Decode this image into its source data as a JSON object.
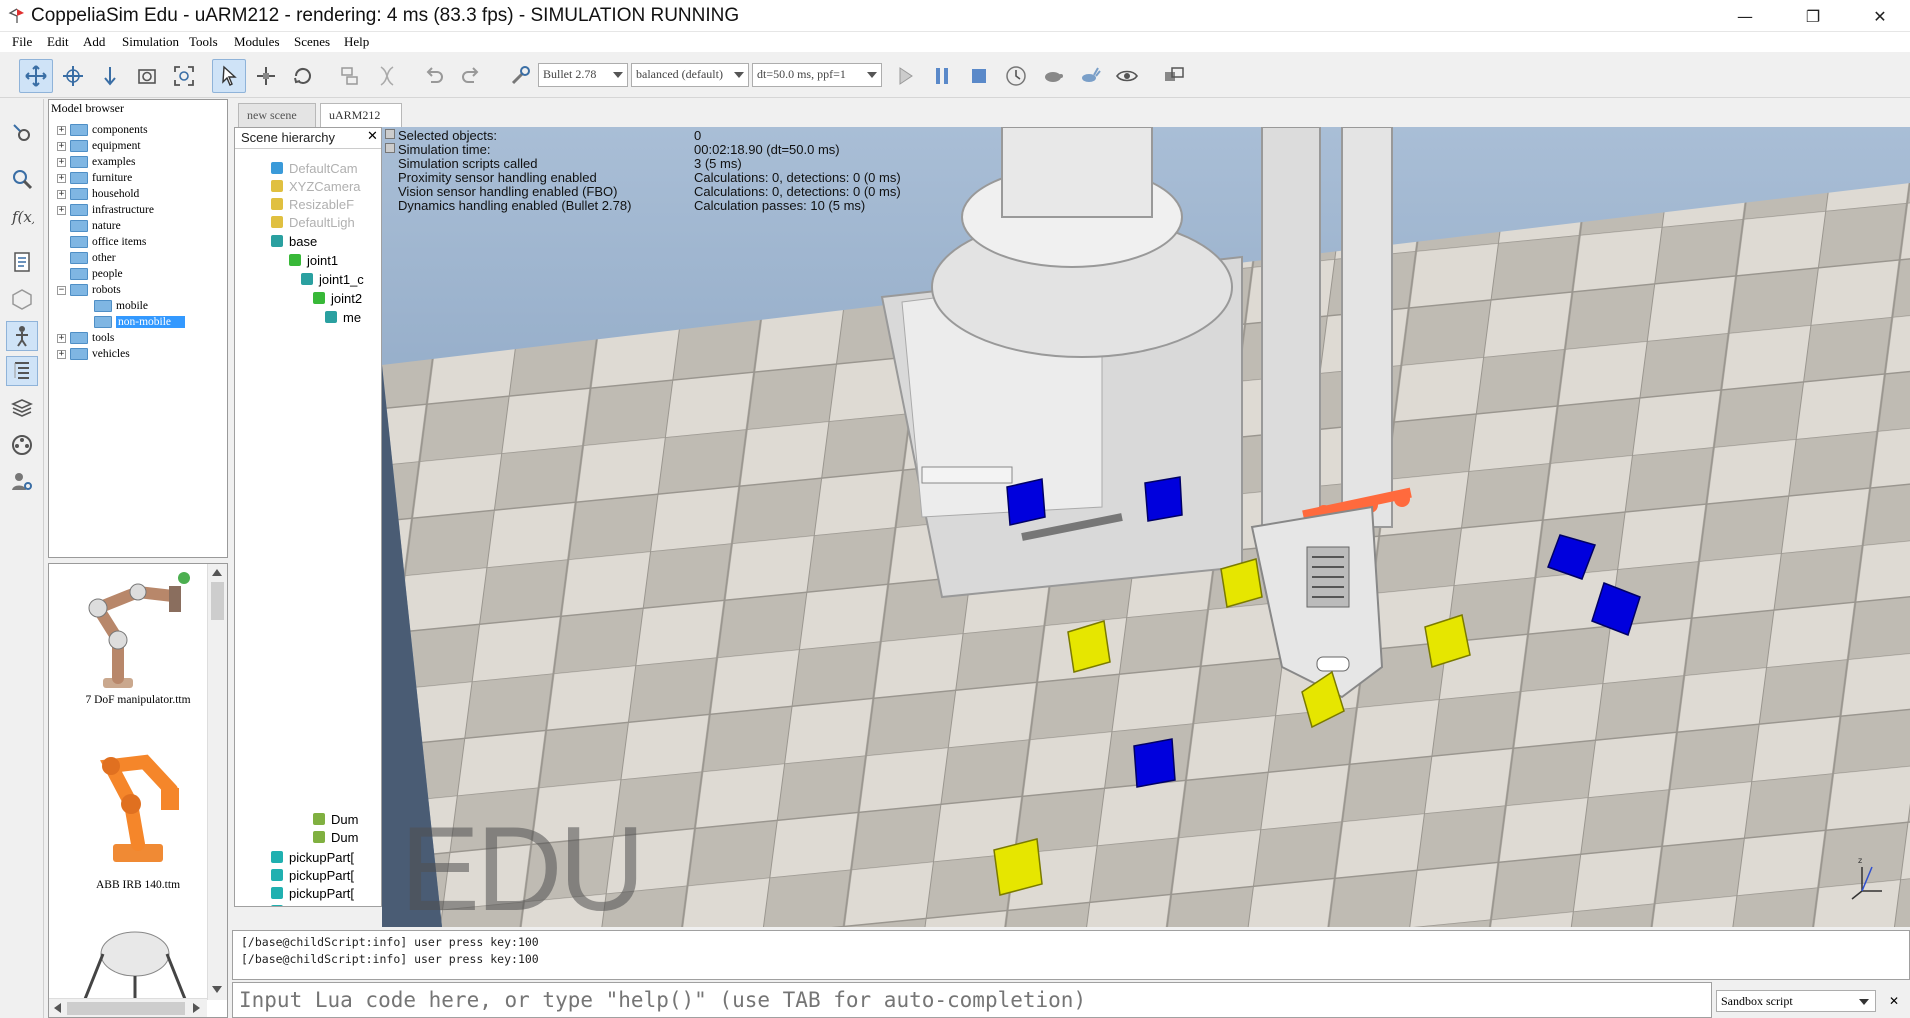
{
  "window": {
    "title": "CoppeliaSim Edu - uARM212 - rendering: 4 ms (83.3 fps) - SIMULATION RUNNING",
    "minimize": "—",
    "restore": "❐",
    "close": "✕"
  },
  "menu": [
    "File",
    "Edit",
    "Add",
    "Simulation",
    "Tools",
    "Modules",
    "Scenes",
    "Help"
  ],
  "toolbar": {
    "engine": "Bullet 2.78",
    "accuracy": "balanced (default)",
    "timestep": "dt=50.0 ms, ppf=1",
    "icons": [
      "move-camera-icon",
      "rotate-camera-icon",
      "shift-camera-icon",
      "zoom-camera-icon",
      "fit-view-icon",
      "select-icon",
      "object-shift-icon",
      "object-rotate-icon",
      "assembly-icon",
      "transfer-dna-icon",
      "undo-icon",
      "redo-icon",
      "dynamics-engine-icon",
      "play-icon",
      "pause-icon",
      "stop-icon",
      "realtime-icon",
      "slow-down-icon",
      "speed-up-icon",
      "visualization-icon",
      "page-selector-icon"
    ]
  },
  "model_browser": {
    "title": "Model browser",
    "items": [
      {
        "label": "components",
        "expander": "+",
        "level": 0
      },
      {
        "label": "equipment",
        "expander": "+",
        "level": 0
      },
      {
        "label": "examples",
        "expander": "+",
        "level": 0
      },
      {
        "label": "furniture",
        "expander": "+",
        "level": 0
      },
      {
        "label": "household",
        "expander": "+",
        "level": 0
      },
      {
        "label": "infrastructure",
        "expander": "+",
        "level": 0
      },
      {
        "label": "nature",
        "expander": "",
        "level": 0
      },
      {
        "label": "office items",
        "expander": "",
        "level": 0
      },
      {
        "label": "other",
        "expander": "",
        "level": 0
      },
      {
        "label": "people",
        "expander": "",
        "level": 0
      },
      {
        "label": "robots",
        "expander": "−",
        "level": 0
      },
      {
        "label": "mobile",
        "expander": "",
        "level": 1
      },
      {
        "label": "non-mobile",
        "expander": "",
        "level": 1,
        "selected": true
      },
      {
        "label": "tools",
        "expander": "+",
        "level": 0
      },
      {
        "label": "vehicles",
        "expander": "+",
        "level": 0
      }
    ],
    "thumbnails": [
      "7 DoF manipulator.ttm",
      "ABB IRB 140.ttm"
    ]
  },
  "tabs": [
    "new scene",
    "uARM212"
  ],
  "scene_hierarchy": {
    "title": "Scene hierarchy",
    "close": "✕",
    "items": [
      {
        "label": "DefaultCam",
        "dim": true
      },
      {
        "label": "XYZCamera",
        "dim": true
      },
      {
        "label": "ResizableF",
        "dim": true
      },
      {
        "label": "DefaultLigh",
        "dim": true
      },
      {
        "label": "base",
        "dim": false
      },
      {
        "label": "joint1",
        "dim": false
      },
      {
        "label": "joint1_c",
        "dim": false
      },
      {
        "label": "joint2",
        "dim": false
      },
      {
        "label": "me",
        "dim": false
      },
      {
        "label": "Dum",
        "dim": false
      },
      {
        "label": "Dum",
        "dim": false
      },
      {
        "label": "pickupPart[",
        "dim": false
      },
      {
        "label": "pickupPart[",
        "dim": false
      },
      {
        "label": "pickupPart[",
        "dim": false
      },
      {
        "label": "pickupPart[",
        "dim": false
      }
    ]
  },
  "sim_info": [
    {
      "label": "Selected objects:",
      "value": "0"
    },
    {
      "label": "Simulation time:",
      "value": "00:02:18.90 (dt=50.0 ms)"
    },
    {
      "label": "Simulation scripts called",
      "value": "3 (5 ms)"
    },
    {
      "label": "Proximity sensor handling enabled",
      "value": "Calculations: 0, detections: 0 (0 ms)"
    },
    {
      "label": "Vision sensor handling enabled (FBO)",
      "value": "Calculations: 0, detections: 0 (0 ms)"
    },
    {
      "label": "Dynamics handling enabled (Bullet 2.78)",
      "value": "Calculation passes: 10 (5 ms)"
    }
  ],
  "watermark": "EDU",
  "console": {
    "lines": [
      "[/base@childScript:info] user press key:100",
      "[/base@childScript:info] user press key:100"
    ],
    "placeholder": "Input Lua code here, or type \"help()\" (use TAB for auto-completion)",
    "script_selector": "Sandbox script",
    "close": "✕"
  },
  "colors": {
    "selection": "#3399ff",
    "blue_cube": "#0000dd",
    "yellow_cube": "#e6e600",
    "sky": "#8aa6c4"
  }
}
